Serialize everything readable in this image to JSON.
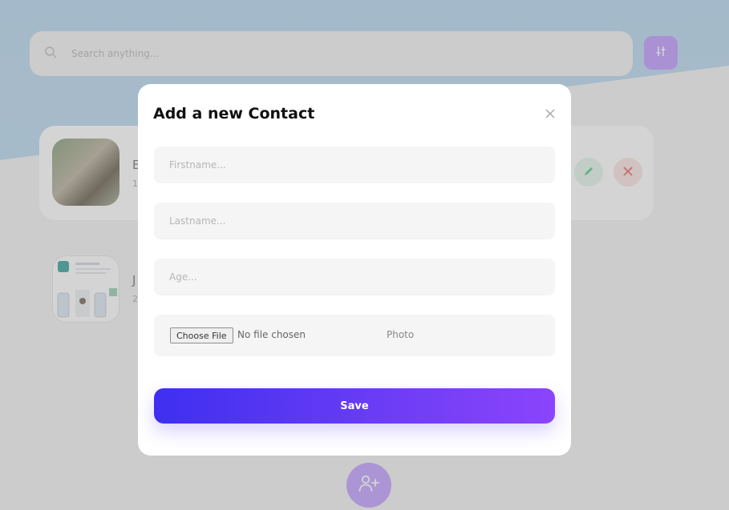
{
  "search": {
    "placeholder": "Search anything..."
  },
  "contacts": [
    {
      "name": "E",
      "sub": "1"
    },
    {
      "name": "J",
      "sub": "2"
    }
  ],
  "modal": {
    "title": "Add a new Contact",
    "fields": {
      "firstname_placeholder": "Firstname...",
      "lastname_placeholder": "Lastname...",
      "age_placeholder": "Age..."
    },
    "file": {
      "button_label": "Choose File",
      "status": "No file chosen",
      "label": "Photo"
    },
    "save_label": "Save"
  },
  "colors": {
    "accent_start": "#3e2ff0",
    "accent_end": "#8b44fb",
    "background_blue": "#b9d8ef",
    "filter_button": "#c29cff",
    "fab": "#c5a2ff"
  },
  "icons": {
    "search": "search-icon",
    "filter": "sliders-icon",
    "edit": "pencil-icon",
    "delete": "close-icon",
    "close_modal": "close-icon",
    "fab": "user-add-icon"
  }
}
